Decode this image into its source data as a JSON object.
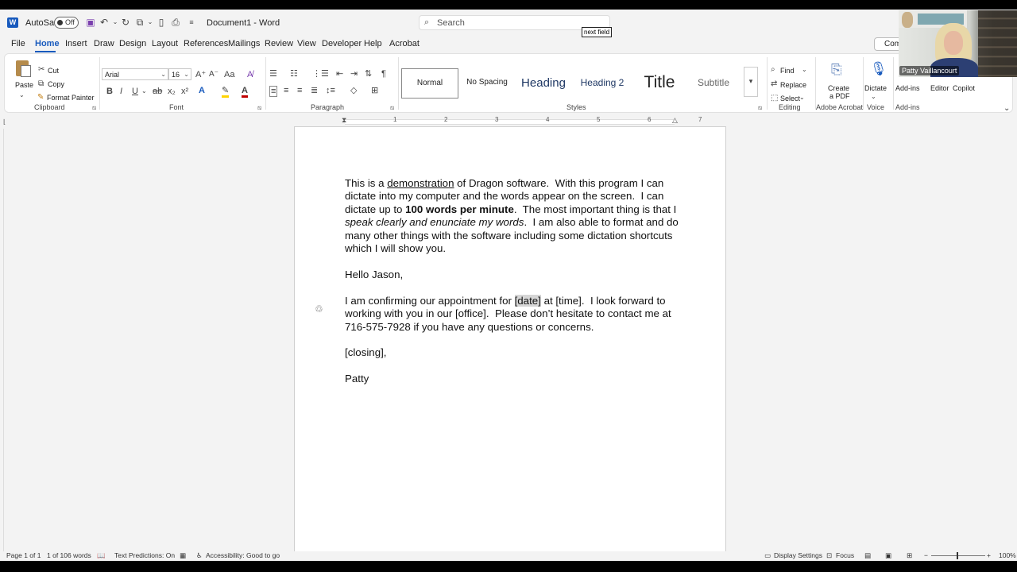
{
  "app": {
    "autosave_label": "AutoSave",
    "autosave_state": "Off",
    "title": "Document1 - Word",
    "search_placeholder": "Search",
    "tooltip": "next field"
  },
  "menu": {
    "tabs": [
      "File",
      "Home",
      "Insert",
      "Draw",
      "Design",
      "Layout",
      "References",
      "Mailings",
      "Review",
      "View",
      "Developer",
      "Help",
      "Acrobat"
    ],
    "comments_label": "Com"
  },
  "ribbon": {
    "clipboard": {
      "paste": "Paste",
      "cut": "Cut",
      "copy": "Copy",
      "format_painter": "Format Painter",
      "label": "Clipboard"
    },
    "font": {
      "family": "Arial",
      "size": "16",
      "label": "Font"
    },
    "paragraph": {
      "label": "Paragraph"
    },
    "styles": {
      "items": [
        "Normal",
        "No Spacing",
        "Heading",
        "Heading 2",
        "Title",
        "Subtitle"
      ],
      "label": "Styles"
    },
    "editing": {
      "find": "Find",
      "replace": "Replace",
      "select": "Select",
      "label": "Editing"
    },
    "acrobat": {
      "create_pdf_line1": "Create",
      "create_pdf_line2": "a PDF",
      "label": "Adobe Acrobat"
    },
    "voice": {
      "dictate": "Dictate",
      "label": "Voice"
    },
    "addins": {
      "addins": "Add-ins",
      "editor": "Editor",
      "copilot": "Copilot",
      "label": "Add-ins"
    }
  },
  "ruler": {
    "numbers": [
      "1",
      "2",
      "3",
      "4",
      "5",
      "6",
      "7"
    ]
  },
  "document": {
    "p1_a": "This is a ",
    "p1_u": "demonstration",
    "p1_b": " of Dragon software.  With this program I can dictate into my computer and the words appear on the screen.  I can dictate up to ",
    "p1_bold": "100 words per minute",
    "p1_c": ".  The most important thing is that I ",
    "p1_ital": "speak clearly and enunciate my words",
    "p1_d": ".  I am also able to format and do many other things with the software including some dictation shortcuts which I will show you.",
    "greeting": "Hello Jason,",
    "p2_a": "I am confirming our appointment for ",
    "p2_hl": "[date]",
    "p2_b": " at [time].  I look forward to working with you in our [office].  Please don’t hesitate to contact me at 716-575-7928 if you have any questions or concerns.",
    "closing": "[closing],",
    "signature": "Patty"
  },
  "video": {
    "name": "Patty Vaillancourt"
  },
  "status": {
    "page": "Page 1 of 1",
    "words": "1 of 106 words",
    "predictions": "Text Predictions: On",
    "accessibility": "Accessibility: Good to go",
    "display_settings": "Display Settings",
    "focus": "Focus",
    "zoom": "100%"
  },
  "colors": {
    "accent": "#185abd",
    "font_color": "#c00000",
    "highlight": "#ffd400"
  }
}
